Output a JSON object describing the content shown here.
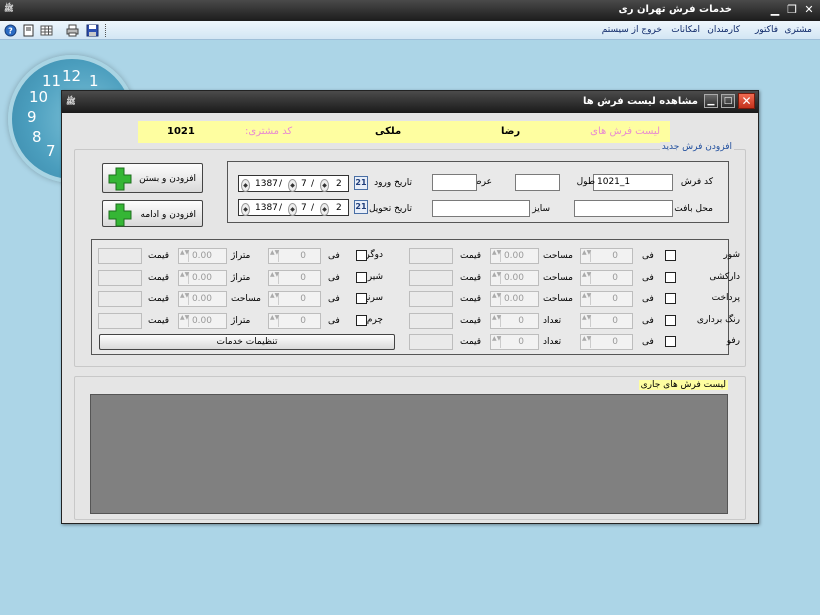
{
  "app": {
    "title": "خدمات فرش تهران ری",
    "logo_text": "ﷺ"
  },
  "menu": {
    "items": [
      "مشتری",
      "فاکتور",
      "کارمندان",
      "امکانات",
      "خروج از سیستم"
    ]
  },
  "toolbar": {
    "icons": [
      "help-icon",
      "page-icon",
      "grid-icon",
      "print-icon",
      "save-icon"
    ]
  },
  "clock": {
    "numbers": [
      "12",
      "1",
      "11",
      "10",
      "9",
      "8",
      "7"
    ]
  },
  "dialog": {
    "title": "مشاهده لیست فرش ها",
    "header": {
      "list_label": "لیست فرش های",
      "customer_name": "رضا",
      "customer_family": "ملکی",
      "code_label": "کد مشتری:",
      "code_value": "1021"
    },
    "new_group_legend": "افزودن فرش جدید",
    "form": {
      "code_label": "کد فرش",
      "code_value": "1021_1",
      "length_label": "طول",
      "width_label": "عرض",
      "weave_label": "محل بافت",
      "size_label": "سایز",
      "entry_date_label": "تاریخ ورود",
      "delivery_date_label": "تاریخ تحویل",
      "entry_date": {
        "day": "2",
        "month": "7",
        "year": "1387"
      },
      "delivery_date": {
        "day": "2",
        "month": "7",
        "year": "1387"
      },
      "calendar_label": "21"
    },
    "buttons": {
      "add_close": "افزودن و بستن",
      "add_continue": "افزودن و ادامه",
      "service_settings": "تنظیمات خدمات"
    },
    "services_right": [
      {
        "name": "شور",
        "qty_label": "مساحت",
        "qty": "0.00",
        "fee_label": "فی",
        "fee": "0",
        "price_label": "قیمت"
      },
      {
        "name": "دارکشی",
        "qty_label": "مساحت",
        "qty": "0.00",
        "fee_label": "فی",
        "fee": "0",
        "price_label": "قیمت"
      },
      {
        "name": "پرداخت",
        "qty_label": "مساحت",
        "qty": "0.00",
        "fee_label": "فی",
        "fee": "0",
        "price_label": "قیمت"
      },
      {
        "name": "رنگ برداری",
        "qty_label": "تعداد",
        "qty": "0",
        "fee_label": "فی",
        "fee": "0",
        "price_label": "قیمت"
      },
      {
        "name": "رفو",
        "qty_label": "تعداد",
        "qty": "0",
        "fee_label": "فی",
        "fee": "0",
        "price_label": "قیمت"
      }
    ],
    "services_left": [
      {
        "name": "دوگره",
        "qty_label": "متراژ",
        "qty": "0.00",
        "fee_label": "فی",
        "fee": "0",
        "price_label": "قیمت"
      },
      {
        "name": "شیرازه",
        "qty_label": "متراژ",
        "qty": "0.00",
        "fee_label": "فی",
        "fee": "0",
        "price_label": "قیمت"
      },
      {
        "name": "سرنخ",
        "qty_label": "مساحت",
        "qty": "0.00",
        "fee_label": "فی",
        "fee": "0",
        "price_label": "قیمت"
      },
      {
        "name": "چرم",
        "qty_label": "متراژ",
        "qty": "0.00",
        "fee_label": "فی",
        "fee": "0",
        "price_label": "قیمت"
      }
    ],
    "current_list_legend": "لیست فرش های جاری"
  }
}
